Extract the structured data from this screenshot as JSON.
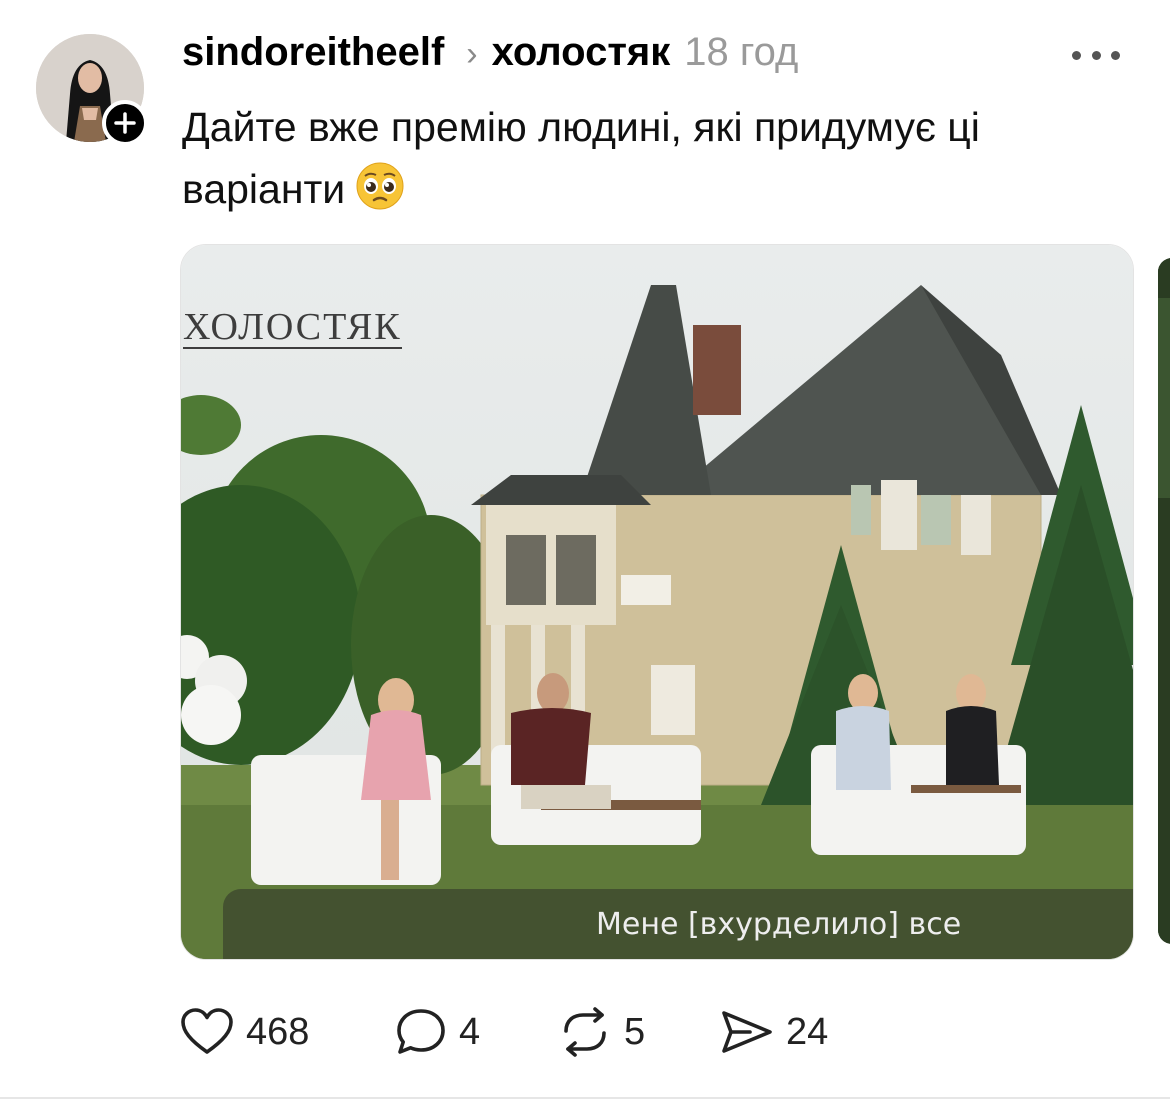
{
  "post": {
    "username": "sindoreitheelf",
    "community": "холостяк",
    "time_ago": "18 год",
    "text": "Дайте вже премію людині, які придумує ці варіанти",
    "emoji_name": "pleading-face-emoji"
  },
  "media": {
    "show_logo": "ХОЛОСТЯК",
    "subtitle": "Мене [вхурделило] все"
  },
  "actions": {
    "likes": "468",
    "replies": "4",
    "reposts": "5",
    "shares": "24"
  },
  "icons": {
    "more": "more-horizontal-icon",
    "follow": "plus-icon",
    "like": "heart-icon",
    "reply": "comment-icon",
    "repost": "repost-icon",
    "share": "send-icon"
  },
  "colors": {
    "text": "#000000",
    "muted": "#9a9a9a",
    "follow_badge": "#000000"
  }
}
